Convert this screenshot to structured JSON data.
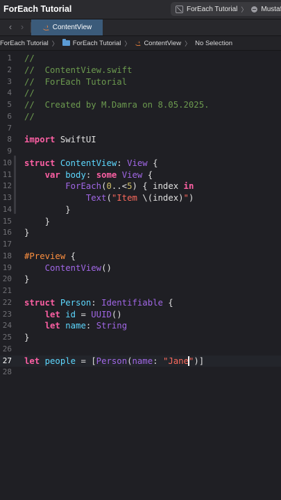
{
  "window": {
    "title": "ForEach Tutorial",
    "scheme": "ForEach Tutorial",
    "destination": "Mustafa"
  },
  "tabs": [
    {
      "label": "ContentView",
      "active": true
    }
  ],
  "jumpbar": {
    "project": "ForEach Tutorial",
    "group": "ForEach Tutorial",
    "file": "ContentView",
    "selection": "No Selection"
  },
  "editor": {
    "current_line": 27,
    "lines": [
      {
        "n": "1",
        "tokens": [
          {
            "t": "//",
            "k": "comment"
          }
        ]
      },
      {
        "n": "2",
        "tokens": [
          {
            "t": "//  ContentView.swift",
            "k": "comment"
          }
        ]
      },
      {
        "n": "3",
        "tokens": [
          {
            "t": "//  ForEach Tutorial",
            "k": "comment"
          }
        ]
      },
      {
        "n": "4",
        "tokens": [
          {
            "t": "//",
            "k": "comment"
          }
        ]
      },
      {
        "n": "5",
        "tokens": [
          {
            "t": "//  Created by M.Damra on 8.05.2025.",
            "k": "comment"
          }
        ]
      },
      {
        "n": "6",
        "tokens": [
          {
            "t": "//",
            "k": "comment"
          }
        ]
      },
      {
        "n": "7",
        "tokens": []
      },
      {
        "n": "8",
        "tokens": [
          {
            "t": "import",
            "k": "kw"
          },
          {
            "t": " SwiftUI",
            "k": "plain"
          }
        ]
      },
      {
        "n": "9",
        "tokens": []
      },
      {
        "n": "10",
        "tokens": [
          {
            "t": "struct",
            "k": "kw"
          },
          {
            "t": " ",
            "k": "plain"
          },
          {
            "t": "ContentView",
            "k": "type"
          },
          {
            "t": ": ",
            "k": "plain"
          },
          {
            "t": "View",
            "k": "ident"
          },
          {
            "t": " {",
            "k": "plain"
          }
        ]
      },
      {
        "n": "11",
        "tokens": [
          {
            "t": "    ",
            "k": "plain"
          },
          {
            "t": "var",
            "k": "kw"
          },
          {
            "t": " ",
            "k": "plain"
          },
          {
            "t": "body",
            "k": "type"
          },
          {
            "t": ": ",
            "k": "plain"
          },
          {
            "t": "some",
            "k": "kw"
          },
          {
            "t": " ",
            "k": "plain"
          },
          {
            "t": "View",
            "k": "ident"
          },
          {
            "t": " {",
            "k": "plain"
          }
        ]
      },
      {
        "n": "12",
        "tokens": [
          {
            "t": "        ",
            "k": "plain"
          },
          {
            "t": "ForEach",
            "k": "ident"
          },
          {
            "t": "(",
            "k": "plain"
          },
          {
            "t": "0",
            "k": "num"
          },
          {
            "t": "..<",
            "k": "plain"
          },
          {
            "t": "5",
            "k": "num"
          },
          {
            "t": ") { index ",
            "k": "plain"
          },
          {
            "t": "in",
            "k": "kw"
          }
        ]
      },
      {
        "n": "13",
        "tokens": [
          {
            "t": "            ",
            "k": "plain"
          },
          {
            "t": "Text",
            "k": "ident"
          },
          {
            "t": "(",
            "k": "plain"
          },
          {
            "t": "\"Item ",
            "k": "str"
          },
          {
            "t": "\\(index)",
            "k": "plain"
          },
          {
            "t": "\"",
            "k": "str"
          },
          {
            "t": ")",
            "k": "plain"
          }
        ]
      },
      {
        "n": "14",
        "tokens": [
          {
            "t": "        }",
            "k": "plain"
          }
        ]
      },
      {
        "n": "15",
        "tokens": [
          {
            "t": "    }",
            "k": "plain"
          }
        ]
      },
      {
        "n": "16",
        "tokens": [
          {
            "t": "}",
            "k": "plain"
          }
        ]
      },
      {
        "n": "17",
        "tokens": []
      },
      {
        "n": "18",
        "tokens": [
          {
            "t": "#Preview",
            "k": "macro"
          },
          {
            "t": " {",
            "k": "plain"
          }
        ]
      },
      {
        "n": "19",
        "tokens": [
          {
            "t": "    ",
            "k": "plain"
          },
          {
            "t": "ContentView",
            "k": "ident"
          },
          {
            "t": "()",
            "k": "plain"
          }
        ]
      },
      {
        "n": "20",
        "tokens": [
          {
            "t": "}",
            "k": "plain"
          }
        ]
      },
      {
        "n": "21",
        "tokens": []
      },
      {
        "n": "22",
        "tokens": [
          {
            "t": "struct",
            "k": "kw"
          },
          {
            "t": " ",
            "k": "plain"
          },
          {
            "t": "Person",
            "k": "type"
          },
          {
            "t": ": ",
            "k": "plain"
          },
          {
            "t": "Identifiable",
            "k": "ident"
          },
          {
            "t": " {",
            "k": "plain"
          }
        ]
      },
      {
        "n": "23",
        "tokens": [
          {
            "t": "    ",
            "k": "plain"
          },
          {
            "t": "let",
            "k": "kw"
          },
          {
            "t": " ",
            "k": "plain"
          },
          {
            "t": "id",
            "k": "type"
          },
          {
            "t": " = ",
            "k": "plain"
          },
          {
            "t": "UUID",
            "k": "ident"
          },
          {
            "t": "()",
            "k": "plain"
          }
        ]
      },
      {
        "n": "24",
        "tokens": [
          {
            "t": "    ",
            "k": "plain"
          },
          {
            "t": "let",
            "k": "kw"
          },
          {
            "t": " ",
            "k": "plain"
          },
          {
            "t": "name",
            "k": "type"
          },
          {
            "t": ": ",
            "k": "plain"
          },
          {
            "t": "String",
            "k": "ident"
          }
        ]
      },
      {
        "n": "25",
        "tokens": [
          {
            "t": "}",
            "k": "plain"
          }
        ]
      },
      {
        "n": "26",
        "tokens": []
      },
      {
        "n": "27",
        "tokens": [
          {
            "t": "let",
            "k": "kw"
          },
          {
            "t": " ",
            "k": "plain"
          },
          {
            "t": "people",
            "k": "type"
          },
          {
            "t": " = [",
            "k": "plain"
          },
          {
            "t": "Person",
            "k": "ident"
          },
          {
            "t": "(",
            "k": "plain"
          },
          {
            "t": "name",
            "k": "ident"
          },
          {
            "t": ": ",
            "k": "plain"
          },
          {
            "t": "\"Jane",
            "k": "str"
          },
          {
            "t": "",
            "k": "caret"
          },
          {
            "t": "\"",
            "k": "str"
          },
          {
            "t": ")]",
            "k": "plain"
          }
        ]
      },
      {
        "n": "28",
        "tokens": []
      }
    ]
  },
  "colors": {
    "background": "#1f1f24",
    "comment": "#6c9a4f",
    "keyword": "#fc5fa3",
    "declaration": "#5dd8ff",
    "type_ref": "#a167e6",
    "number": "#d0bf69",
    "string": "#fc6a5d",
    "macro": "#fd8f3f",
    "active_tab": "#3b5b7a"
  }
}
